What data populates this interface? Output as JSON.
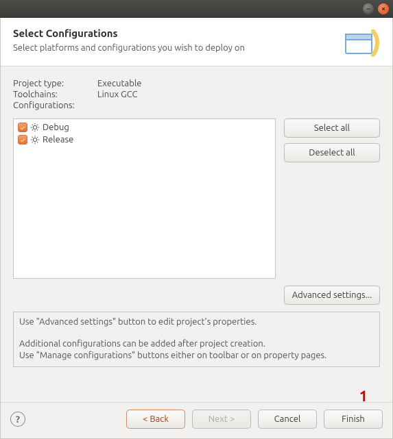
{
  "window": {
    "minimize_glyph": "–",
    "close_glyph": "×"
  },
  "header": {
    "title": "Select Configurations",
    "subtitle": "Select platforms and configurations you wish to deploy on"
  },
  "meta": {
    "project_type_label": "Project type:",
    "project_type_value": "Executable",
    "toolchains_label": "Toolchains:",
    "toolchains_value": "Linux GCC",
    "configurations_label": "Configurations:"
  },
  "configurations": [
    {
      "name": "Debug",
      "checked": true
    },
    {
      "name": "Release",
      "checked": true
    }
  ],
  "buttons": {
    "select_all": "Select all",
    "deselect_all": "Deselect all",
    "advanced": "Advanced settings..."
  },
  "hint": {
    "line1": "Use \"Advanced settings\" button to edit project's properties.",
    "line2": "Additional configurations can be added after project creation.",
    "line3": "Use \"Manage configurations\" buttons either on toolbar or on property pages."
  },
  "footer": {
    "help": "?",
    "back": "< Back",
    "next": "Next >",
    "cancel": "Cancel",
    "finish": "Finish"
  },
  "callout": {
    "finish_marker": "1"
  },
  "colors": {
    "accent": "#dd4814"
  }
}
